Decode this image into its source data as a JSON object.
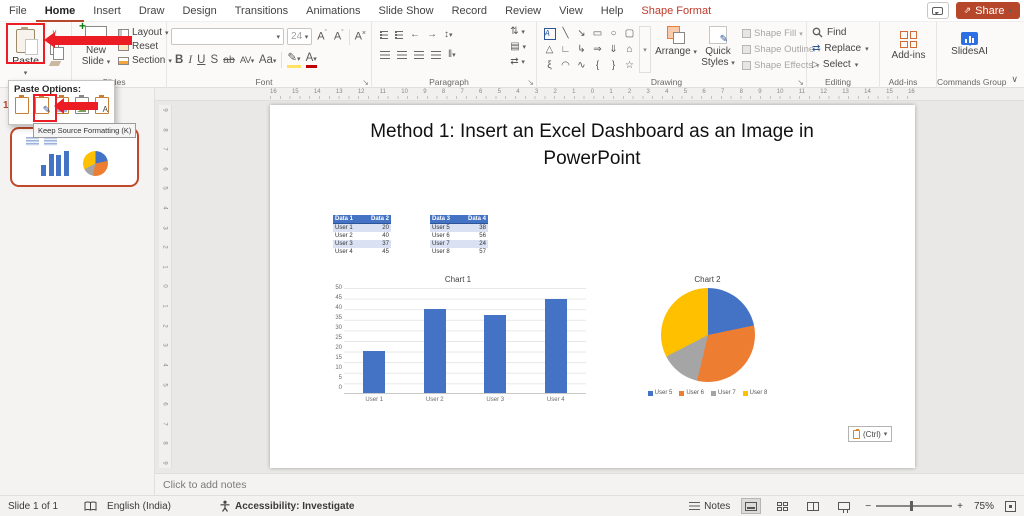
{
  "menu": {
    "tabs": [
      "File",
      "Home",
      "Insert",
      "Draw",
      "Design",
      "Transitions",
      "Animations",
      "Slide Show",
      "Record",
      "Review",
      "View",
      "Help",
      "Shape Format"
    ],
    "active_tab": "Home",
    "contextual_tab": "Shape Format",
    "share_label": "Share"
  },
  "ribbon": {
    "clipboard": {
      "paste_label": "Paste"
    },
    "slides": {
      "new_slide_label": "New Slide",
      "layout_label": "Layout",
      "reset_label": "Reset",
      "section_label": "Section",
      "group_label": "Slides"
    },
    "font": {
      "size_value": "24",
      "bold": "B",
      "italic": "I",
      "underline": "U",
      "shadow": "S",
      "strike": "ab",
      "spacing": "AV",
      "case_label": "Aa",
      "grow": "A",
      "shrink": "A",
      "clear": "A",
      "color": "A",
      "group_label": "Font"
    },
    "paragraph": {
      "group_label": "Paragraph"
    },
    "drawing": {
      "arrange_label": "Arrange",
      "quick_styles_label": "Quick Styles",
      "shape_fill_label": "Shape Fill",
      "shape_outline_label": "Shape Outline",
      "shape_effects_label": "Shape Effects",
      "group_label": "Drawing"
    },
    "editing": {
      "find_label": "Find",
      "replace_label": "Replace",
      "select_label": "Select",
      "group_label": "Editing"
    },
    "addins": {
      "button_label": "Add-ins",
      "group_label": "Add-ins"
    },
    "slidesai": {
      "button_label": "SlidesAI",
      "group_label": "Commands Group"
    }
  },
  "paste_options": {
    "header": "Paste Options:",
    "tooltip": "Keep Source Formatting (K)"
  },
  "slide_panel": {
    "slide_number": "1"
  },
  "slide": {
    "title": "Method 1: Insert an Excel Dashboard as an Image in PowerPoint"
  },
  "tables": [
    {
      "headers": [
        "Data 1",
        "Data 2"
      ],
      "rows": [
        [
          "User 1",
          "20"
        ],
        [
          "User 2",
          "40"
        ],
        [
          "User 3",
          "37"
        ],
        [
          "User 4",
          "45"
        ]
      ]
    },
    {
      "headers": [
        "Data 3",
        "Data 4"
      ],
      "rows": [
        [
          "User 5",
          "38"
        ],
        [
          "User 6",
          "56"
        ],
        [
          "User 7",
          "24"
        ],
        [
          "User 8",
          "57"
        ]
      ]
    }
  ],
  "chart_data": [
    {
      "type": "bar",
      "title": "Chart 1",
      "categories": [
        "User 1",
        "User 2",
        "User 3",
        "User 4"
      ],
      "values": [
        20,
        40,
        37,
        45
      ],
      "ylim": [
        0,
        50
      ],
      "ytick_step": 5,
      "bar_color": "#4472c4",
      "grid": true,
      "legend": false
    },
    {
      "type": "pie",
      "title": "Chart 2",
      "labels": [
        "User 5",
        "User 6",
        "User 7",
        "User 8"
      ],
      "values": [
        38,
        56,
        24,
        57
      ],
      "colors": [
        "#4472c4",
        "#ed7d31",
        "#a5a5a5",
        "#ffc000"
      ],
      "legend_position": "bottom"
    }
  ],
  "floating_paste_button": {
    "label": "(Ctrl)"
  },
  "notes": {
    "placeholder": "Click to add notes"
  },
  "status_bar": {
    "slide_info": "Slide 1 of 1",
    "language": "English (India)",
    "accessibility": "Accessibility: Investigate",
    "notes_label": "Notes",
    "zoom_level": "75%"
  },
  "rulers": {
    "horizontal": [
      16,
      15,
      14,
      13,
      12,
      11,
      10,
      9,
      8,
      7,
      6,
      5,
      4,
      3,
      2,
      1,
      0,
      1,
      2,
      3,
      4,
      5,
      6,
      7,
      8,
      9,
      10,
      11,
      12,
      13,
      14,
      15,
      16
    ],
    "vertical": [
      9,
      8,
      7,
      6,
      5,
      4,
      3,
      2,
      1,
      0,
      1,
      2,
      3,
      4,
      5,
      6,
      7,
      8,
      9
    ]
  },
  "colors": {
    "annotation_red": "#ec1c24",
    "thumbnail_border": "#c0492b",
    "share_button": "#b7472a",
    "accent": "#b7472a",
    "table_header": "#4472c4",
    "table_band": "#d9e1f2"
  }
}
